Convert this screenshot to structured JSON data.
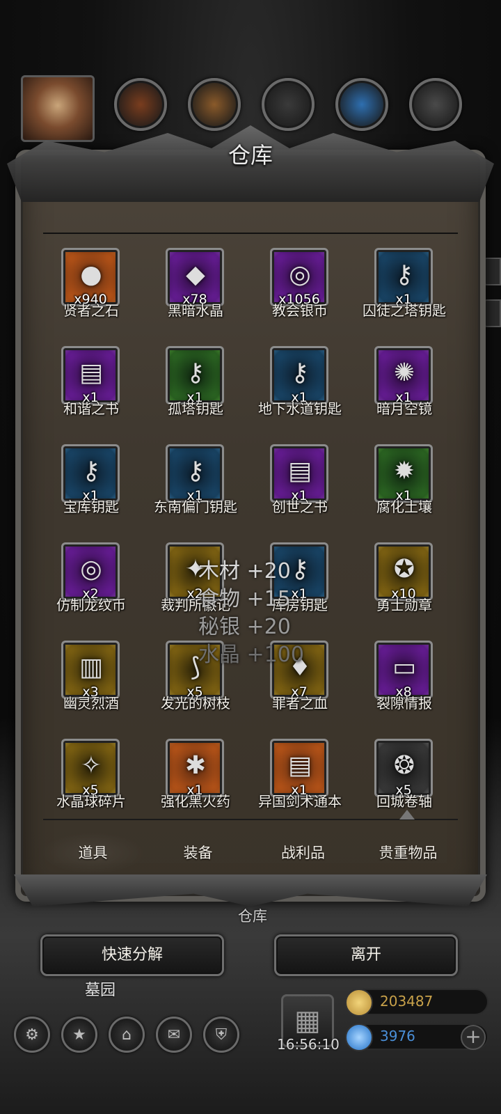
{
  "top_resources": [
    {
      "name": "portrait",
      "color": "#c9a57a"
    },
    {
      "name": "ore-resource",
      "color": "#7a3d1e",
      "count": "?"
    },
    {
      "name": "wood-resource",
      "color": "#8a5a2a",
      "count": "?"
    },
    {
      "name": "stone-resource",
      "color": "#3a3a3a",
      "count": "?"
    },
    {
      "name": "crystal-resource",
      "color": "#2e6fb0",
      "count": "?"
    },
    {
      "name": "iron-resource",
      "color": "#4a4a4a",
      "count": "?"
    }
  ],
  "panel": {
    "title": "仓库"
  },
  "items": [
    {
      "name": "贤者之石",
      "qty": "x940",
      "rarity": "orange",
      "icon": "stone-icon",
      "glyph": "●"
    },
    {
      "name": "黑暗水晶",
      "qty": "x78",
      "rarity": "purple",
      "icon": "crystal-icon",
      "glyph": "◆"
    },
    {
      "name": "教会银币",
      "qty": "x1056",
      "rarity": "purple",
      "icon": "coin-icon",
      "glyph": "◎"
    },
    {
      "name": "囚徒之塔钥匙",
      "qty": "x1",
      "rarity": "blue",
      "icon": "key-icon",
      "glyph": "⚷"
    },
    {
      "name": "和谐之书",
      "qty": "x1",
      "rarity": "purple",
      "icon": "book-icon",
      "glyph": "▤"
    },
    {
      "name": "孤塔钥匙",
      "qty": "x1",
      "rarity": "green",
      "icon": "key-icon",
      "glyph": "⚷"
    },
    {
      "name": "地下水道钥匙",
      "qty": "x1",
      "rarity": "blue",
      "icon": "key-icon",
      "glyph": "⚷"
    },
    {
      "name": "暗月空镜",
      "qty": "x1",
      "rarity": "purple",
      "icon": "mirror-icon",
      "glyph": "✺"
    },
    {
      "name": "宝库钥匙",
      "qty": "x1",
      "rarity": "blue",
      "icon": "key-icon",
      "glyph": "⚷"
    },
    {
      "name": "东南偏门钥匙",
      "qty": "x1",
      "rarity": "blue",
      "icon": "key-icon",
      "glyph": "⚷"
    },
    {
      "name": "创世之书",
      "qty": "x1",
      "rarity": "purple",
      "icon": "book-icon",
      "glyph": "▤"
    },
    {
      "name": "腐化土壤",
      "qty": "x1",
      "rarity": "green",
      "icon": "soil-icon",
      "glyph": "✹"
    },
    {
      "name": "仿制龙纹币",
      "qty": "x2",
      "rarity": "purple",
      "icon": "coin-icon",
      "glyph": "◎"
    },
    {
      "name": "裁判所徽记",
      "qty": "x2",
      "rarity": "gold",
      "icon": "emblem-icon",
      "glyph": "✦"
    },
    {
      "name": "库房钥匙",
      "qty": "x1",
      "rarity": "blue",
      "icon": "key-icon",
      "glyph": "⚷"
    },
    {
      "name": "勇士勋章",
      "qty": "x10",
      "rarity": "gold",
      "icon": "medal-icon",
      "glyph": "✪"
    },
    {
      "name": "幽灵烈酒",
      "qty": "x3",
      "rarity": "gold",
      "icon": "barrel-icon",
      "glyph": "▥"
    },
    {
      "name": "发光的树枝",
      "qty": "x5",
      "rarity": "gold",
      "icon": "branch-icon",
      "glyph": "⟆"
    },
    {
      "name": "罪者之血",
      "qty": "x7",
      "rarity": "gold",
      "icon": "blood-drop-icon",
      "glyph": "♦"
    },
    {
      "name": "裂隙情报",
      "qty": "x8",
      "rarity": "purple",
      "icon": "scroll-icon",
      "glyph": "▭"
    },
    {
      "name": "水晶球碎片",
      "qty": "x5",
      "rarity": "gold",
      "icon": "crystal-shard-icon",
      "glyph": "✧"
    },
    {
      "name": "强化黑火药",
      "qty": "x1",
      "rarity": "orange",
      "icon": "powder-icon",
      "glyph": "✱"
    },
    {
      "name": "异国剑术通本",
      "qty": "x1",
      "rarity": "orange",
      "icon": "book-icon",
      "glyph": "▤"
    },
    {
      "name": "回城卷轴",
      "qty": "x5",
      "rarity": "gray",
      "icon": "vortex-icon",
      "glyph": "❂"
    }
  ],
  "floating_rewards": [
    {
      "text": "木材 +20",
      "color": "#d8d8d8"
    },
    {
      "text": "食物 +15",
      "color": "#bdbdbd"
    },
    {
      "text": "秘银 +20",
      "color": "#9b9b9b"
    },
    {
      "text": "水晶 +100",
      "color": "#6f6f6f"
    }
  ],
  "tabs": [
    {
      "label": "道具",
      "active": true
    },
    {
      "label": "装备",
      "active": false
    },
    {
      "label": "战利品",
      "active": false
    },
    {
      "label": "贵重物品",
      "active": false
    }
  ],
  "location_label": "仓库",
  "buttons": {
    "decompose": "快速分解",
    "leave": "离开"
  },
  "map_name": "墓园",
  "bottom_icons": [
    {
      "name": "settings-gear-icon",
      "glyph": "⚙"
    },
    {
      "name": "star-icon",
      "glyph": "★"
    },
    {
      "name": "castle-icon",
      "glyph": "⌂"
    },
    {
      "name": "mail-icon",
      "glyph": "✉"
    },
    {
      "name": "shield-icon",
      "glyph": "⛨"
    }
  ],
  "clock": "16:56:10",
  "currencies": {
    "gold": {
      "value": "203487",
      "color": "#c9a24a"
    },
    "gems": {
      "value": "3976",
      "color": "#4a8fd8"
    }
  },
  "colors": {
    "panel_bg": "#45403a",
    "frame": "#5d5b57",
    "text": "#f2efe8"
  }
}
